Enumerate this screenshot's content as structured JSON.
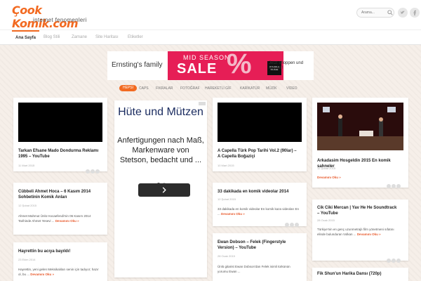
{
  "site": {
    "logo_text": "Çook Komik.com",
    "logo_sub": "internet fenomenleri",
    "search_placeholder": "Arama..."
  },
  "nav": {
    "items": [
      {
        "label": "Ana Sayfa"
      },
      {
        "label": "Blog Stili"
      },
      {
        "label": "Zamane"
      },
      {
        "label": "Site Haritası"
      },
      {
        "label": "Etiketler"
      }
    ]
  },
  "top_ad": {
    "brand": "Ernsting's family",
    "mid_label": "MID SEASON",
    "sale": "SALE",
    "pct": "%",
    "badge": "ONLINE & FILIALE",
    "right_text": "Jetzt shoppen und sparen!"
  },
  "categories": [
    {
      "label": "HEPSİ"
    },
    {
      "label": "CAPS"
    },
    {
      "label": "FIKRALAR"
    },
    {
      "label": "FOTOĞRAF"
    },
    {
      "label": "HAREKETLİ GİF"
    },
    {
      "label": "KARİKATÜR"
    },
    {
      "label": "MÜZİK"
    },
    {
      "label": "VİDEO"
    }
  ],
  "side_ad": {
    "headline": "Hüte und Mützen",
    "body": "Anfertigungen nach Maß, Markenware von Stetson, bedacht und ..."
  },
  "read_more": "Devamını Oku »",
  "posts": {
    "c1": {
      "title": "Tarkan Efsane Mado Dondurma Reklamı 1995 – YouTube",
      "date": "11 Mart 2015"
    },
    "c2": {
      "title": "Cübbeli Ahmet Hoca – 6 Kasım 2014 Sohbetinin Komik Anları",
      "date": "12 Şubat 2015",
      "excerpt": "Ahmet Mahmut Ünlü Hocaefendi'nin 06 Kasım 2014 Tarihinde Ahmet Yesevi ..."
    },
    "c3": {
      "title": "Hayrettin bu acıya bayıldı!",
      "date": "23 Ekim 2014",
      "excerpt": "Hayrettin, yeni gelen Meksikalıları senin için tadıyor; hazır ol, bu ..."
    },
    "c4": {
      "title": "A Capella Türk Pop Tarihi Vol.2 (90lar) – A Capella Boğaziçi",
      "date": "10 Mart 2015"
    },
    "c5": {
      "title": "33 dakikada en komik videolar 2014",
      "date": "12 Şubat 2015",
      "excerpt": "33 dakikada en komik videolar En komik kaza videoları En ..."
    },
    "c6": {
      "title": "Ewan Dobson – Felek (Fingerstyle Version) – YouTube",
      "date": "28 Ocak 2015",
      "excerpt": "Ünlü gitarist Ewan Dobson'dan Felek isimli türkünün yorumu Ewan ..."
    },
    "c7": {
      "title": "Arkadasim Hosgeldin 2015 En komik sahneler",
      "date": "12 Şubat 2015"
    },
    "c8": {
      "title": "Cik Ciki Mercan | Yav He He Soundtrack – YouTube",
      "date": "28 Ocak 2015",
      "excerpt": "Türkiye'nin en genç uzunmetrajlı film yönetmeni sıfatını elinde bulunduran Volkan ..."
    },
    "c9": {
      "title": "Fik Shun'un Harika Dansı (720p)"
    }
  }
}
